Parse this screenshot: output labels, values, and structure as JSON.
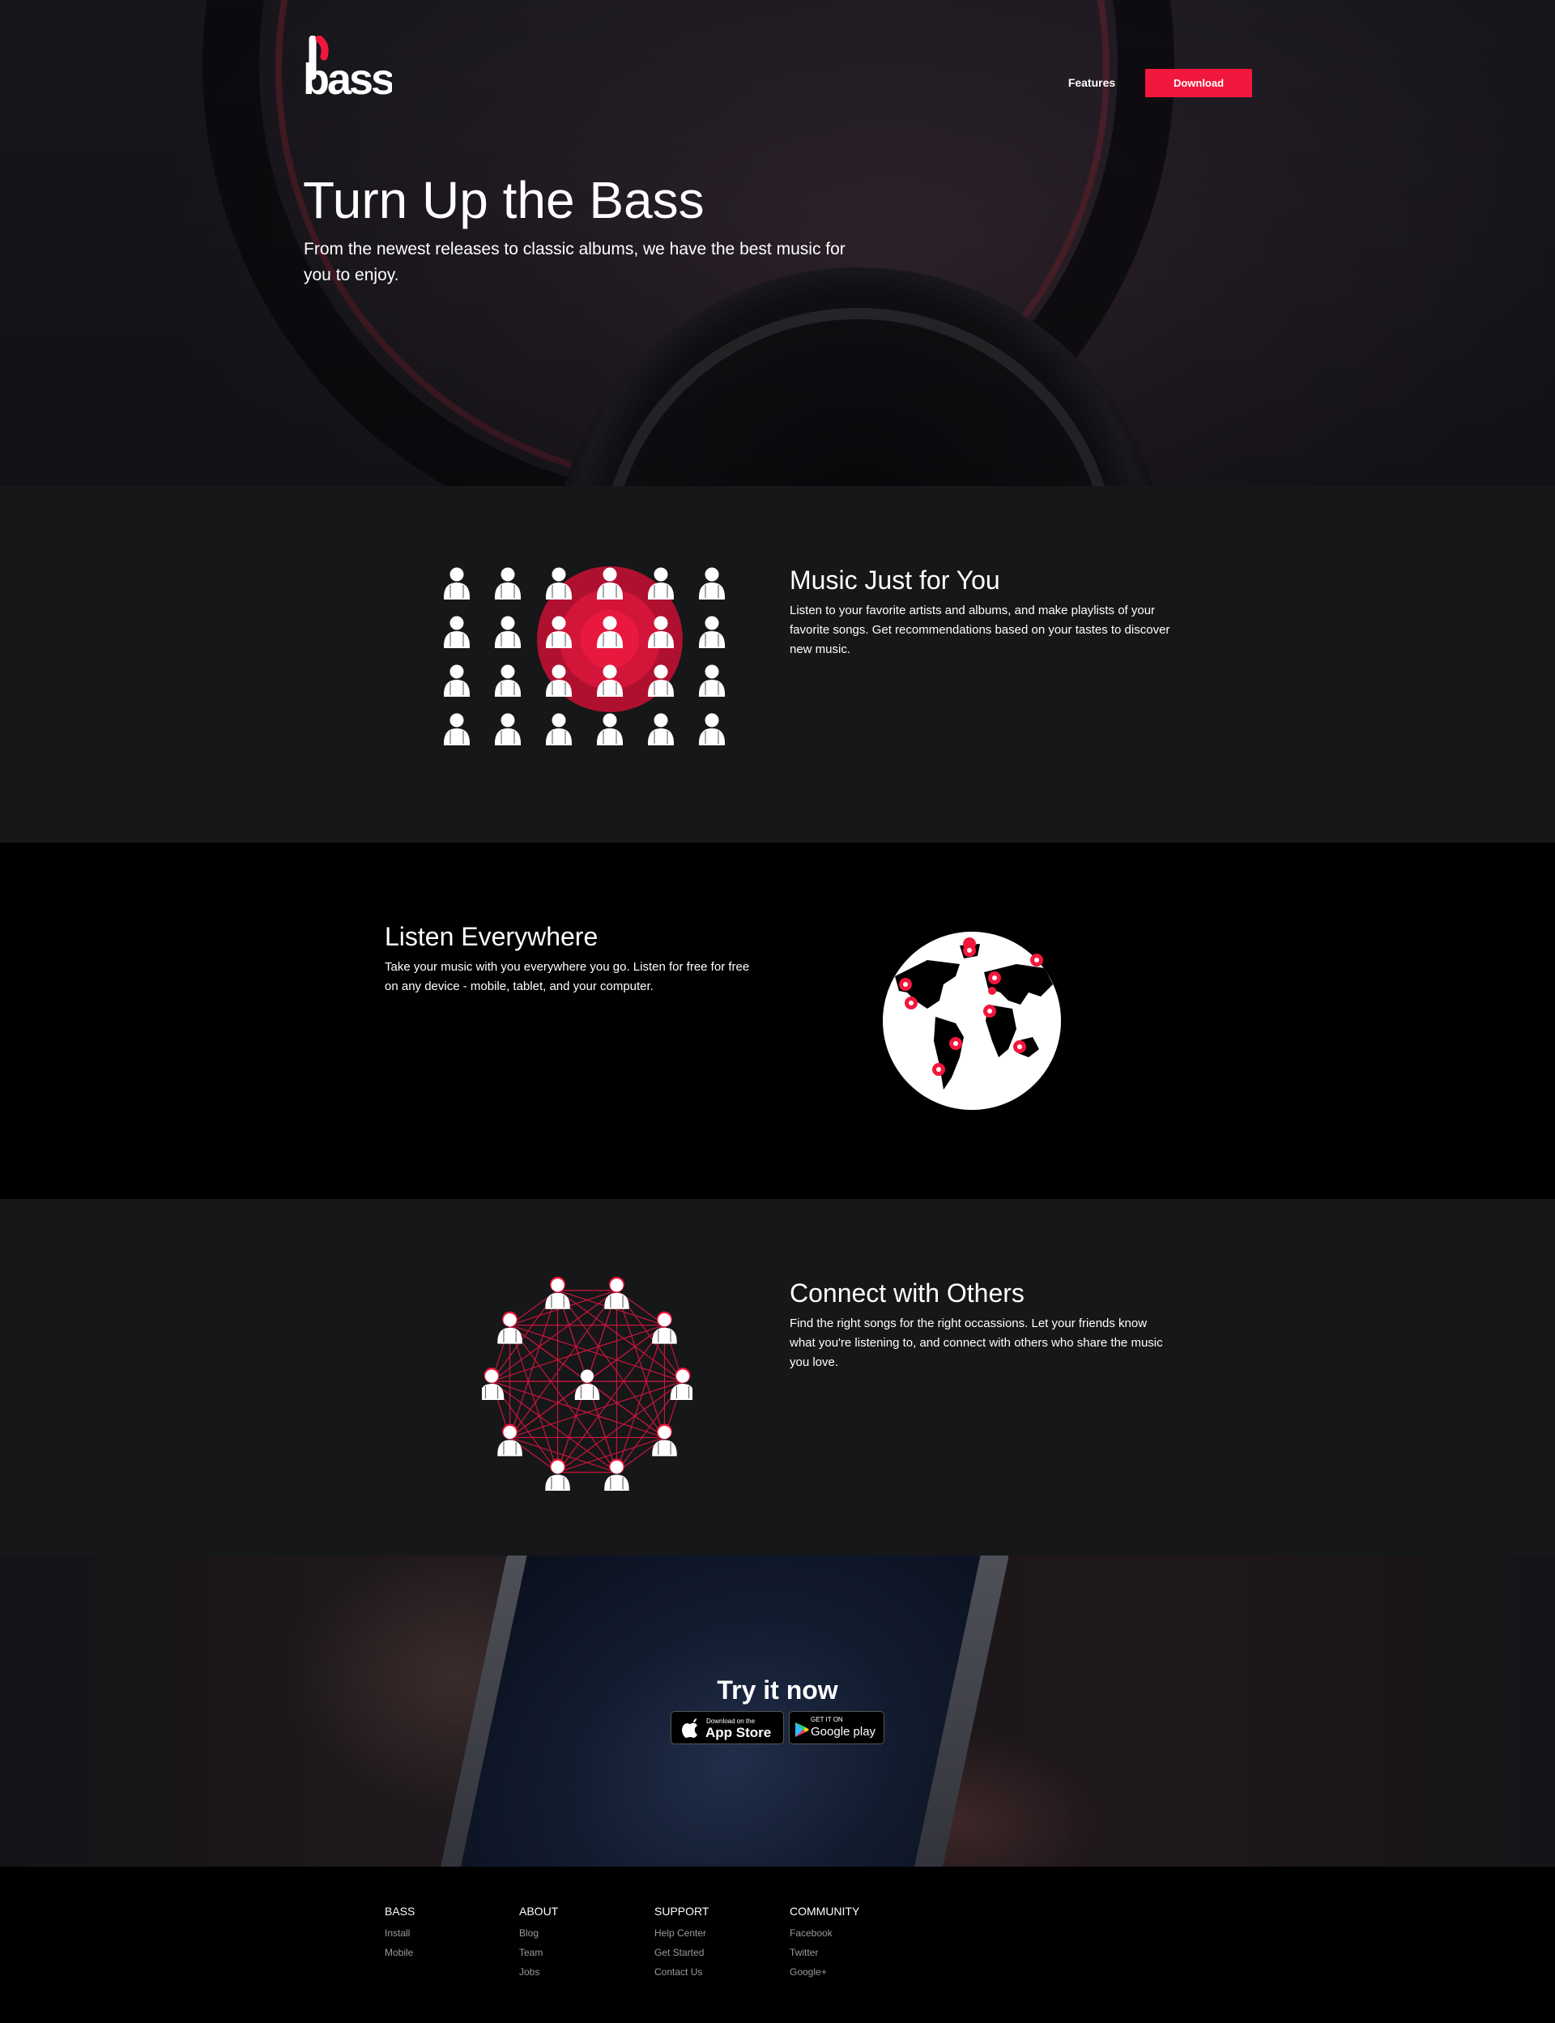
{
  "brand": {
    "logo_text": "bass",
    "accent": "#f2173c"
  },
  "nav": {
    "features_label": "Features",
    "download_label": "Download"
  },
  "hero": {
    "title": "Turn Up the Bass",
    "subtitle": "From the newest releases to classic albums, we have the best music for you to enjoy."
  },
  "features": [
    {
      "title": "Music Just for You",
      "text": "Listen to your favorite artists and albums, and make playlists of your favorite songs. Get recommendations based on your tastes to discover new music.",
      "icon": "people-grid-target-icon"
    },
    {
      "title": "Listen Everywhere",
      "text": "Take your music with you everywhere you go. Listen for free for free on any device - mobile, tablet, and your computer.",
      "icon": "globe-pins-icon"
    },
    {
      "title": "Connect with Others",
      "text": "Find the right songs for the right occassions. Let your friends know what you're listening to, and connect with others who share the music you love.",
      "icon": "people-network-icon"
    }
  ],
  "cta": {
    "title": "Try it now",
    "app_store": {
      "small": "Download on the",
      "big": "App Store"
    },
    "google_play": {
      "small": "GET IT ON",
      "big": "Google play"
    }
  },
  "footer": {
    "columns": [
      {
        "heading": "BASS",
        "links": [
          "Install",
          "Mobile"
        ]
      },
      {
        "heading": "ABOUT",
        "links": [
          "Blog",
          "Team",
          "Jobs"
        ]
      },
      {
        "heading": "SUPPORT",
        "links": [
          "Help Center",
          "Get Started",
          "Contact Us"
        ]
      },
      {
        "heading": "COMMUNITY",
        "links": [
          "Facebook",
          "Twitter",
          "Google+"
        ]
      }
    ]
  }
}
